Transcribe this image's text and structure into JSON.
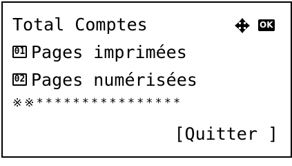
{
  "header": {
    "title": "Total Comptes",
    "nav_icon": "four-way-arrow-icon",
    "ok_label": "OK"
  },
  "menu": {
    "items": [
      {
        "number": "01",
        "label": "Pages imprimées"
      },
      {
        "number": "02",
        "label": "Pages numérisées"
      }
    ]
  },
  "separator": {
    "text": "※※****************"
  },
  "footer": {
    "quit_label": "[Quitter ]"
  }
}
